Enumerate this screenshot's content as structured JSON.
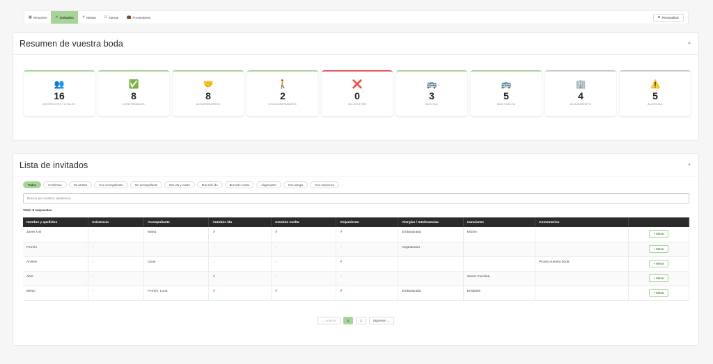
{
  "nav": {
    "tabs": [
      {
        "icon": "▦",
        "label": "Resumen"
      },
      {
        "icon": "✐",
        "label": "Invitados"
      },
      {
        "icon": "⚘",
        "label": "Mesas"
      },
      {
        "icon": "☑",
        "label": "Tareas"
      },
      {
        "icon": "💼",
        "label": "Proveedores"
      }
    ],
    "active_tab": "Invitados",
    "personalize_icon": "⚙",
    "personalize_label": "Personalizar"
  },
  "summary": {
    "title": "Resumen de vuestra boda",
    "collapse_icon": "▲",
    "cards": [
      {
        "icon": "👥",
        "value": "16",
        "label": "Asistentes totales"
      },
      {
        "icon": "✅",
        "value": "8",
        "label": "Confirmados"
      },
      {
        "icon": "🤝",
        "value": "8",
        "label": "Acompañantes"
      },
      {
        "icon": "🚶",
        "value": "2",
        "label": "Sin acompañante"
      },
      {
        "icon": "❌",
        "value": "0",
        "label": "No asisten"
      },
      {
        "icon": "🚌",
        "value": "3",
        "label": "Bus ida"
      },
      {
        "icon": "🚌",
        "value": "5",
        "label": "Bus vuelta"
      },
      {
        "icon": "🏢",
        "value": "4",
        "label": "Alojamiento"
      },
      {
        "icon": "⚠️",
        "value": "5",
        "label": "Alergias"
      }
    ]
  },
  "guests": {
    "title": "Lista de invitados",
    "collapse_icon": "▲",
    "filters": [
      "Todos",
      "Confirman",
      "No asisten",
      "Con acompañante",
      "Sin acompañante",
      "Bus ida y vuelta",
      "Bus solo ida",
      "Bus solo vuelta",
      "Alojamiento",
      "Con alergia",
      "Con canciones"
    ],
    "active_filter": "Todos",
    "search_placeholder": "Buscar por nombre, asistencia...",
    "total_text": "Total: 8 respuestas",
    "columns": [
      "Nombre y apellidos",
      "Asistencia",
      "Acompañante",
      "Autobús ida",
      "Autobús vuelta",
      "Alojamiento",
      "Alergias / Intolerancias",
      "Canciones",
      "Comentarios",
      ""
    ],
    "rows": [
      {
        "name": "Javier Uni",
        "asistencia": "✓",
        "acompanante": "Marta",
        "bus_ida": "✗",
        "bus_vuelta": "✗",
        "alojamiento": "✗",
        "alergias": "Embarazada",
        "canciones": "MODA",
        "comentarios": "",
        "action": "+ Mesa"
      },
      {
        "name": "Fermin",
        "asistencia": "✓",
        "acompanante": "",
        "bus_ida": "✓",
        "bus_vuelta": "✓",
        "alojamiento": "✓",
        "alergias": "Vegetariano",
        "canciones": "",
        "comentarios": "",
        "action": "+ Mesa"
      },
      {
        "name": "Andres",
        "asistencia": "✓",
        "acompanante": "Uxue",
        "bus_ida": "✓",
        "bus_vuelta": "✓",
        "alojamiento": "✗",
        "alergias": "",
        "canciones": "",
        "comentarios": "Pronto nuestra boda",
        "action": "+ Mesa"
      },
      {
        "name": "Aitor",
        "asistencia": "✓",
        "acompanante": "",
        "bus_ida": "✗",
        "bus_vuelta": "✓",
        "alojamiento": "✓",
        "alergias": "",
        "canciones": "Sweet Caroline",
        "comentarios": "",
        "action": "+ Mesa"
      },
      {
        "name": "Mirian",
        "asistencia": "✓",
        "acompanante": "Fermin, Luna",
        "bus_ida": "✗",
        "bus_vuelta": "✗",
        "alojamiento": "✗",
        "alergias": "Embarazada",
        "canciones": "Ensildois",
        "comentarios": "",
        "action": "+ Mesa"
      }
    ],
    "pager": {
      "prev": "← Anterior",
      "pages": [
        "1",
        "2"
      ],
      "current": "1",
      "next": "Siguiente →"
    }
  },
  "colors": {
    "accent": "#a8d49a",
    "danger": "#e23a3a",
    "header_dark": "#2a2a2a"
  }
}
